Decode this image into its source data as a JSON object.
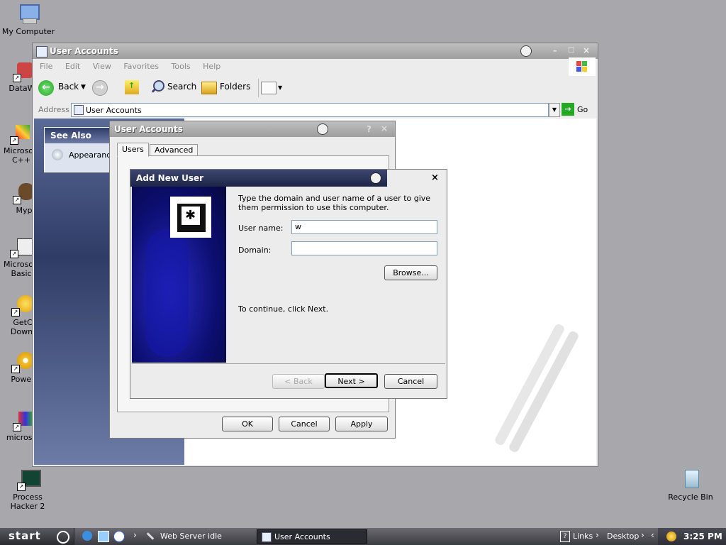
{
  "desktop": {
    "icons": [
      {
        "label": "My Computer"
      },
      {
        "label": "DataWa"
      },
      {
        "label": "Microsoft C++"
      },
      {
        "label": "Myp"
      },
      {
        "label": "Microsoft Basic"
      },
      {
        "label": "GetC Downl"
      },
      {
        "label": "Power"
      },
      {
        "label": "microsofl"
      },
      {
        "label": "Process Hacker 2"
      },
      {
        "label": "Recycle Bin"
      }
    ]
  },
  "explorer": {
    "title": "User Accounts",
    "menu": [
      "File",
      "Edit",
      "View",
      "Favorites",
      "Tools",
      "Help"
    ],
    "toolbar": {
      "back": "Back",
      "search": "Search",
      "folders": "Folders"
    },
    "address_label": "Address",
    "address_value": "User Accounts",
    "go_label": "Go",
    "see_also": {
      "header": "See Also",
      "item": "Appearance"
    }
  },
  "ua_dialog": {
    "title": "User Accounts",
    "help": "?",
    "tabs": [
      "Users",
      "Advanced"
    ],
    "buttons": {
      "ok": "OK",
      "cancel": "Cancel",
      "apply": "Apply"
    }
  },
  "add_user": {
    "title": "Add New User",
    "intro": "Type the domain and user name of a user to give them permission to use this computer.",
    "username_label": "User name:",
    "username_value": "w",
    "domain_label": "Domain:",
    "domain_value": "",
    "browse": "Browse...",
    "continue_text": "To continue, click Next.",
    "back": "< Back",
    "next": "Next >",
    "cancel": "Cancel"
  },
  "taskbar": {
    "start": "start",
    "tasks": [
      "Web Server idle",
      "User Accounts"
    ],
    "links": "Links",
    "desktop": "Desktop",
    "clock": "3:25 PM"
  },
  "colors": {
    "desktop": "#a8a8ac",
    "title_active": "#1d2647",
    "sidebar": "#2e3c66"
  }
}
